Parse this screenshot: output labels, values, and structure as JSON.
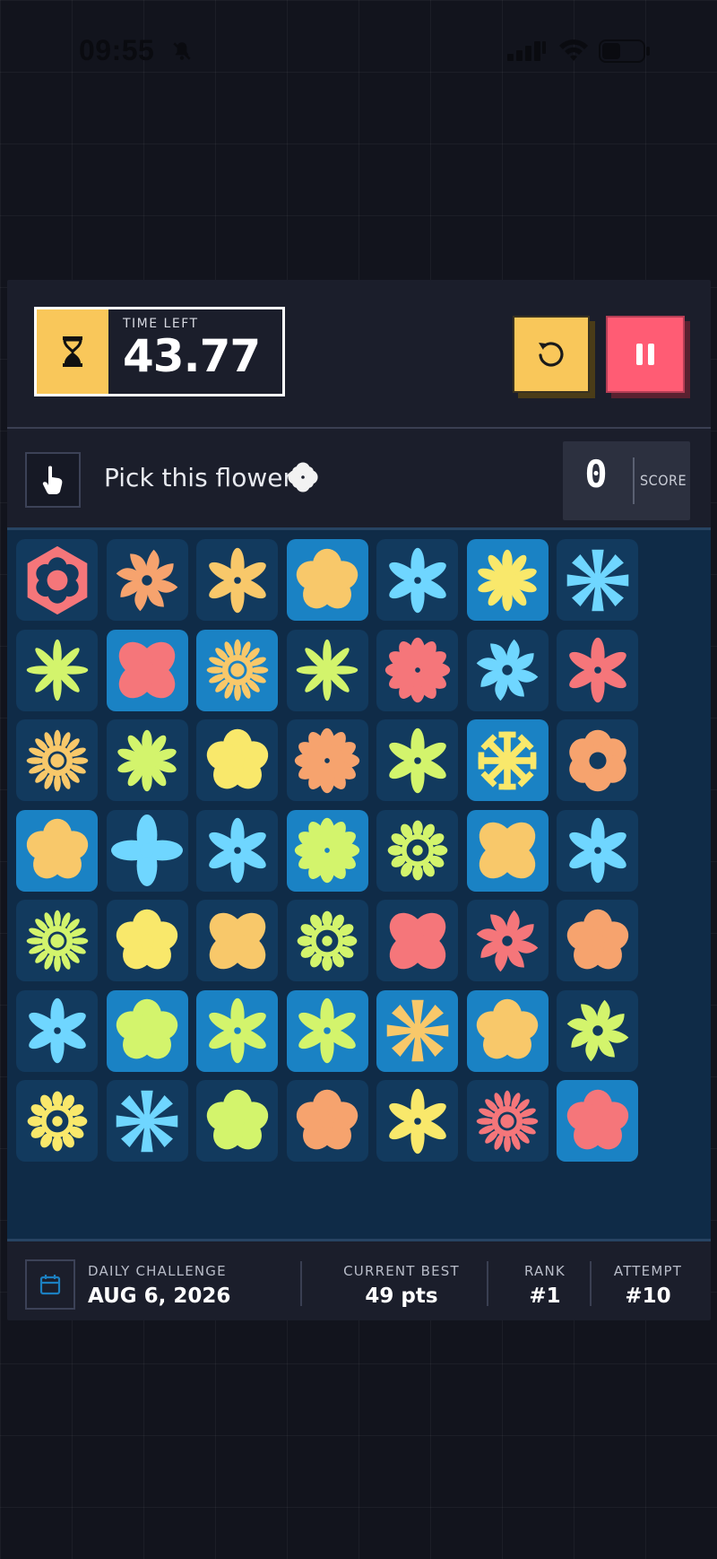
{
  "status_bar": {
    "time": "09:55"
  },
  "timer": {
    "label": "TIME LEFT",
    "value": "43.77"
  },
  "prompt": {
    "text": "Pick this flower",
    "target_icon": "four-petal-flower-icon"
  },
  "score": {
    "value": "0",
    "label": "SCORE"
  },
  "colors": {
    "yellow": "#f9c75a",
    "red": "#ff5c74",
    "tile_dark": "#123a5e",
    "tile_light": "#1a82c4",
    "coral": "#f5767a",
    "orange": "#f6a36e",
    "gold": "#f8c86a",
    "sky": "#6fd6ff",
    "lemon": "#f9e86b",
    "lime": "#d3f46c"
  },
  "grid": {
    "rows": [
      [
        [
          "light-dark-hex",
          "dark",
          "coral"
        ],
        [
          "pinwheel",
          "dark",
          "orange"
        ],
        [
          "star",
          "dark",
          "gold"
        ],
        [
          "round",
          "light",
          "gold"
        ],
        [
          "star",
          "dark",
          "sky"
        ],
        [
          "daisy",
          "light",
          "lemon"
        ],
        [
          "spokes",
          "dark",
          "sky"
        ]
      ],
      [
        [
          "spike",
          "dark",
          "lime"
        ],
        [
          "four",
          "light",
          "coral"
        ],
        [
          "sunburst",
          "light",
          "gold"
        ],
        [
          "spike",
          "dark",
          "lime"
        ],
        [
          "spiky",
          "dark",
          "coral"
        ],
        [
          "pinwheel",
          "dark",
          "sky"
        ],
        [
          "star",
          "dark",
          "coral"
        ]
      ],
      [
        [
          "sunburst",
          "dark",
          "gold"
        ],
        [
          "daisy",
          "dark",
          "lime"
        ],
        [
          "round",
          "dark",
          "lemon"
        ],
        [
          "spiky",
          "dark",
          "orange"
        ],
        [
          "star",
          "dark",
          "lime"
        ],
        [
          "snow",
          "light",
          "lemon"
        ],
        [
          "hex",
          "dark",
          "orange"
        ]
      ],
      [
        [
          "round",
          "light",
          "gold"
        ],
        [
          "diamond",
          "dark",
          "sky"
        ],
        [
          "star",
          "dark",
          "sky"
        ],
        [
          "spiky",
          "light",
          "lime"
        ],
        [
          "ring",
          "dark",
          "lime"
        ],
        [
          "four",
          "light",
          "gold"
        ],
        [
          "star",
          "dark",
          "sky"
        ]
      ],
      [
        [
          "sunburst",
          "dark",
          "lime"
        ],
        [
          "round",
          "dark",
          "lemon"
        ],
        [
          "four",
          "dark",
          "gold"
        ],
        [
          "ring",
          "dark",
          "lime"
        ],
        [
          "four",
          "dark",
          "coral"
        ],
        [
          "pinwheel",
          "dark",
          "coral"
        ],
        [
          "round",
          "dark",
          "orange"
        ]
      ],
      [
        [
          "star",
          "dark",
          "sky"
        ],
        [
          "round",
          "light",
          "lime"
        ],
        [
          "star",
          "light",
          "lime"
        ],
        [
          "star",
          "light",
          "lime"
        ],
        [
          "spokes",
          "light",
          "gold"
        ],
        [
          "round",
          "light",
          "gold"
        ],
        [
          "pinwheel",
          "dark",
          "lime"
        ]
      ],
      [
        [
          "ring",
          "dark",
          "lemon"
        ],
        [
          "spokes",
          "dark",
          "sky"
        ],
        [
          "round",
          "dark",
          "lime"
        ],
        [
          "round",
          "dark",
          "orange"
        ],
        [
          "star",
          "dark",
          "lemon"
        ],
        [
          "sunburst",
          "dark",
          "coral"
        ],
        [
          "round",
          "light",
          "coral"
        ]
      ]
    ]
  },
  "footer": {
    "daily_label": "DAILY CHALLENGE",
    "daily_value": "AUG 6, 2026",
    "best_label": "CURRENT BEST",
    "best_value": "49 pts",
    "rank_label": "RANK",
    "rank_value": "#1",
    "attempt_label": "ATTEMPT",
    "attempt_value": "#10"
  }
}
